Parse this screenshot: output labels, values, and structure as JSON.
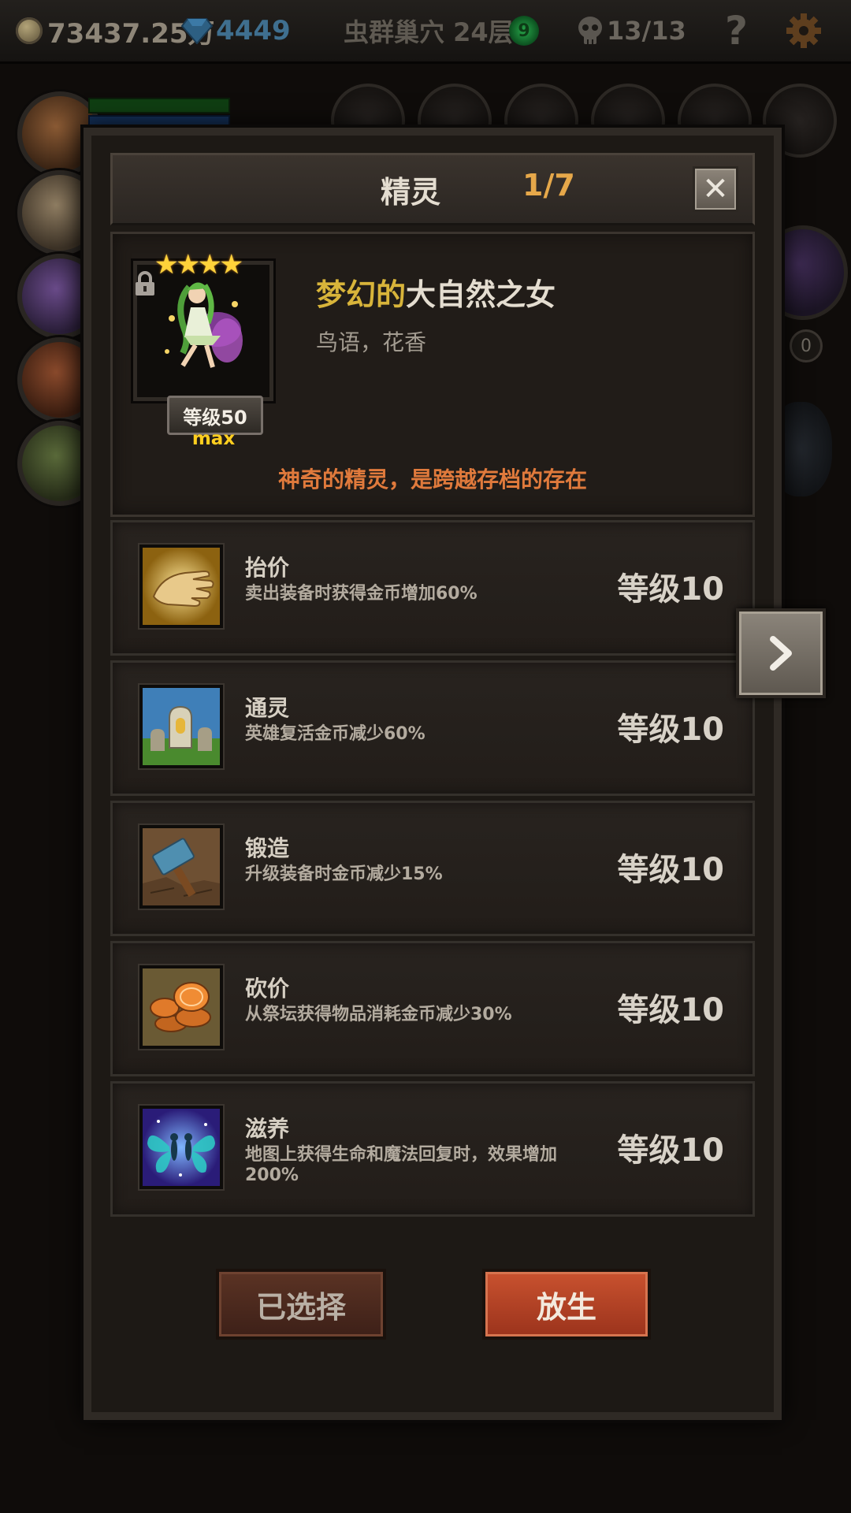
{
  "topbar": {
    "gold": "73437.25万",
    "gems": "4449",
    "floor": "虫群巢穴 24层",
    "green_badge": "9",
    "kills": "13/13",
    "help": "?"
  },
  "background": {
    "right_count": "0"
  },
  "modal": {
    "title": "精灵",
    "page_indicator": "1/7",
    "close_icon": "✕",
    "sprite": {
      "stars": "★★★★",
      "level_label": "等级50",
      "max_label": "max",
      "name_prefix": "梦幻的",
      "name_main": "大自然之女",
      "subtitle": "鸟语，花香",
      "description": "神奇的精灵，是跨越存档的存在"
    },
    "skills": [
      {
        "name": "抬价",
        "desc": "卖出装备时获得金币增加60%",
        "level": "等级10",
        "icon": "hand-icon"
      },
      {
        "name": "通灵",
        "desc": "英雄复活金币减少60%",
        "level": "等级10",
        "icon": "tombstone-icon"
      },
      {
        "name": "锻造",
        "desc": "升级装备时金币减少15%",
        "level": "等级10",
        "icon": "hammer-icon"
      },
      {
        "name": "砍价",
        "desc": "从祭坛获得物品消耗金币减少30%",
        "level": "等级10",
        "icon": "coins-icon"
      },
      {
        "name": "滋养",
        "desc": "地图上获得生命和魔法回复时，效果增加200%",
        "level": "等级10",
        "icon": "fairies-icon"
      }
    ],
    "buttons": {
      "selected": "已选择",
      "release": "放生"
    }
  },
  "colors": {
    "accent_orange": "#e6a84a",
    "desc_orange": "#e07a3c",
    "name_gold": "#d8b43a",
    "star_yellow": "#ffd23a",
    "button_red": "#c9522f"
  }
}
